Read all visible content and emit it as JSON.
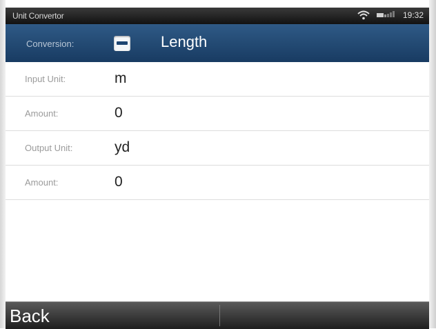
{
  "statusbar": {
    "app_name": "Unit Convertor",
    "time": "19:32",
    "icons": [
      "wifi-icon",
      "battery-icon"
    ]
  },
  "header": {
    "conversion_label": "Conversion:",
    "conversion_value": "Length",
    "icon": "length-icon"
  },
  "rows": [
    {
      "label": "Input Unit:",
      "value": "m"
    },
    {
      "label": "Amount:",
      "value": "0"
    },
    {
      "label": "Output Unit:",
      "value": "yd"
    },
    {
      "label": "Amount:",
      "value": "0"
    }
  ],
  "bottombar": {
    "back_label": "Back"
  },
  "colors": {
    "header_bg": "#1f456f",
    "statusbar_bg": "#1a1a1a",
    "bottombar_bg": "#3a3a3a"
  }
}
